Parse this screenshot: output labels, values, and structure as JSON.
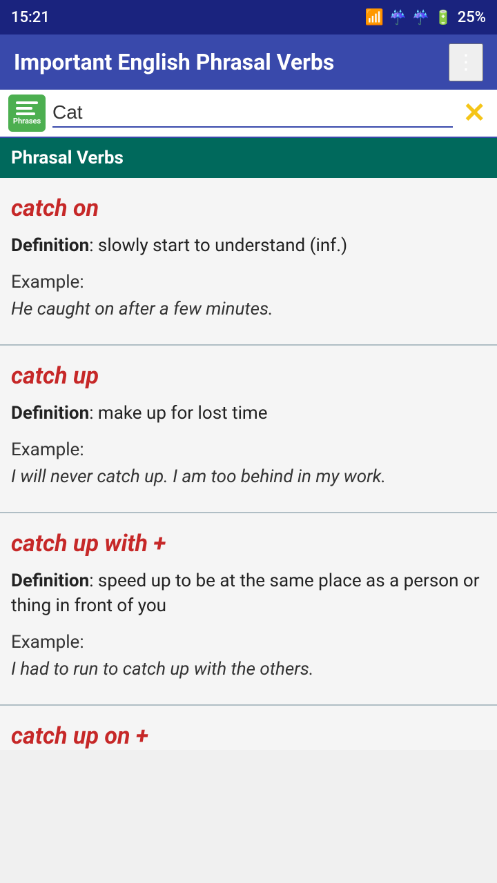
{
  "statusBar": {
    "time": "15:21",
    "batteryPercent": "25%"
  },
  "appBar": {
    "title": "Important English Phrasal Verbs",
    "moreIcon": "⋮"
  },
  "searchBar": {
    "inputValue": "Cat",
    "inputPlaceholder": "",
    "bookLabel": "Phrases",
    "clearButton": "✕"
  },
  "sectionHeader": {
    "label": "Phrasal Verbs"
  },
  "verbs": [
    {
      "title": "catch on",
      "definitionLabel": "Definition",
      "definitionText": ": slowly start to understand (inf.)",
      "exampleLabel": "Example:",
      "exampleText": "He caught on after a few minutes."
    },
    {
      "title": "catch up",
      "definitionLabel": "Definition",
      "definitionText": ": make up for lost time",
      "exampleLabel": "Example:",
      "exampleText": "I will never catch up. I am too behind in my work."
    },
    {
      "title": "catch up with +",
      "definitionLabel": "Definition",
      "definitionText": ": speed up to be at the same place as a person or thing in front of you",
      "exampleLabel": "Example:",
      "exampleText": "I had to run to catch up with the others."
    }
  ],
  "partialVerb": {
    "title": "catch up on +"
  }
}
